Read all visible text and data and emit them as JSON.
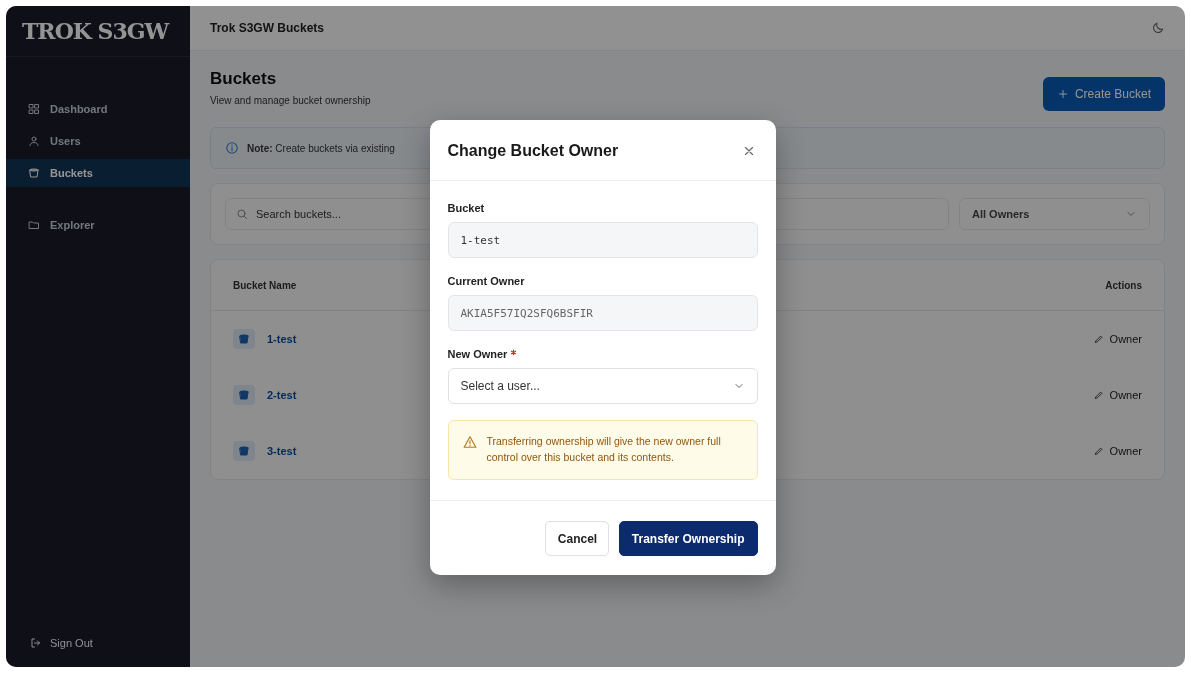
{
  "sidebar": {
    "logo": "TROK S3GW",
    "items": [
      {
        "label": "Dashboard",
        "selected": false
      },
      {
        "label": "Users",
        "selected": false
      },
      {
        "label": "Buckets",
        "selected": true
      },
      {
        "label": "Explorer",
        "selected": false
      }
    ],
    "sign_out": "Sign Out"
  },
  "header": {
    "title": "Trok S3GW Buckets"
  },
  "page": {
    "title": "Buckets",
    "subtitle": "View and manage bucket ownership",
    "create_button": "Create Bucket"
  },
  "note": {
    "text": "**Note:** Create buckets via existing"
  },
  "filters": {
    "search_placeholder": "Search buckets...",
    "owner_filter": "All Owners"
  },
  "table": {
    "columns": [
      "Bucket Name",
      "Actions"
    ],
    "rows": [
      {
        "name": "1-test",
        "action": "Owner"
      },
      {
        "name": "2-test",
        "action": "Owner"
      },
      {
        "name": "3-test",
        "action": "Owner"
      }
    ]
  },
  "dialog": {
    "title": "Change Bucket Owner",
    "fields": [
      {
        "kind": "readonly",
        "label": "Bucket",
        "value": "1-test",
        "required": false
      },
      {
        "kind": "readonly",
        "label": "Current Owner",
        "value": "AKIA5F57IQ2SFQ6BSFIR",
        "required": false
      },
      {
        "kind": "select",
        "label": "New Owner",
        "placeholder": "Select a user...",
        "required": true
      }
    ],
    "warning": "Transferring ownership will give the new owner full control over this bucket and its contents.",
    "buttons": [
      {
        "label": "Cancel",
        "kind": "secondary"
      },
      {
        "label": "Transfer Ownership",
        "kind": "primary"
      }
    ]
  }
}
